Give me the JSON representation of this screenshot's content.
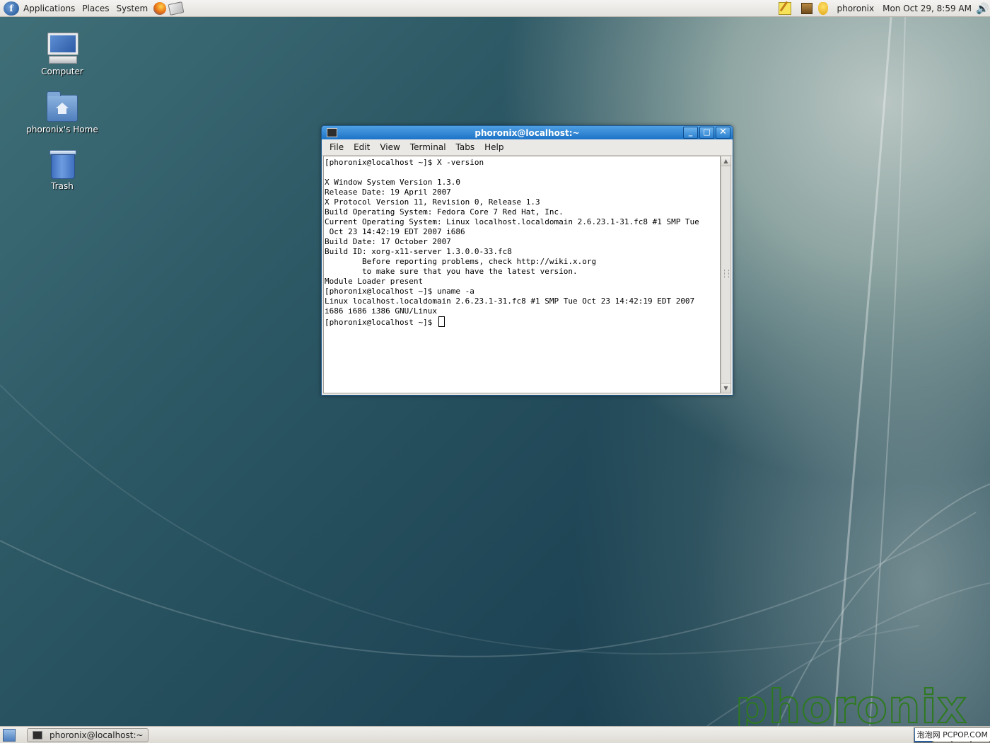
{
  "top_panel": {
    "menus": [
      "Applications",
      "Places",
      "System"
    ],
    "launchers": [
      "firefox-icon",
      "mail-icon"
    ],
    "tray_icons": [
      "notes-icon",
      "package-icon",
      "shield-icon"
    ],
    "user": "phoronix",
    "clock": "Mon Oct 29,  8:59 AM",
    "volume_icon": "volume-icon"
  },
  "desktop_icons": [
    {
      "label": "Computer",
      "icon": "computer-icon"
    },
    {
      "label": "phoronix's Home",
      "icon": "home-folder-icon"
    },
    {
      "label": "Trash",
      "icon": "trash-icon"
    }
  ],
  "terminal": {
    "title": "phoronix@localhost:~",
    "menus": [
      "File",
      "Edit",
      "View",
      "Terminal",
      "Tabs",
      "Help"
    ],
    "lines": [
      "[phoronix@localhost ~]$ X -version",
      "",
      "X Window System Version 1.3.0",
      "Release Date: 19 April 2007",
      "X Protocol Version 11, Revision 0, Release 1.3",
      "Build Operating System: Fedora Core 7 Red Hat, Inc.",
      "Current Operating System: Linux localhost.localdomain 2.6.23.1-31.fc8 #1 SMP Tue",
      " Oct 23 14:42:19 EDT 2007 i686",
      "Build Date: 17 October 2007",
      "Build ID: xorg-x11-server 1.3.0.0-33.fc8",
      "        Before reporting problems, check http://wiki.x.org",
      "        to make sure that you have the latest version.",
      "Module Loader present",
      "[phoronix@localhost ~]$ uname -a",
      "Linux localhost.localdomain 2.6.23.1-31.fc8 #1 SMP Tue Oct 23 14:42:19 EDT 2007",
      "i686 i686 i386 GNU/Linux"
    ],
    "prompt": "[phoronix@localhost ~]$ "
  },
  "bottom_panel": {
    "task_label": "phoronix@localhost:~"
  },
  "watermark": "phoronix",
  "credit": "泡泡网 PCPOP.COM"
}
